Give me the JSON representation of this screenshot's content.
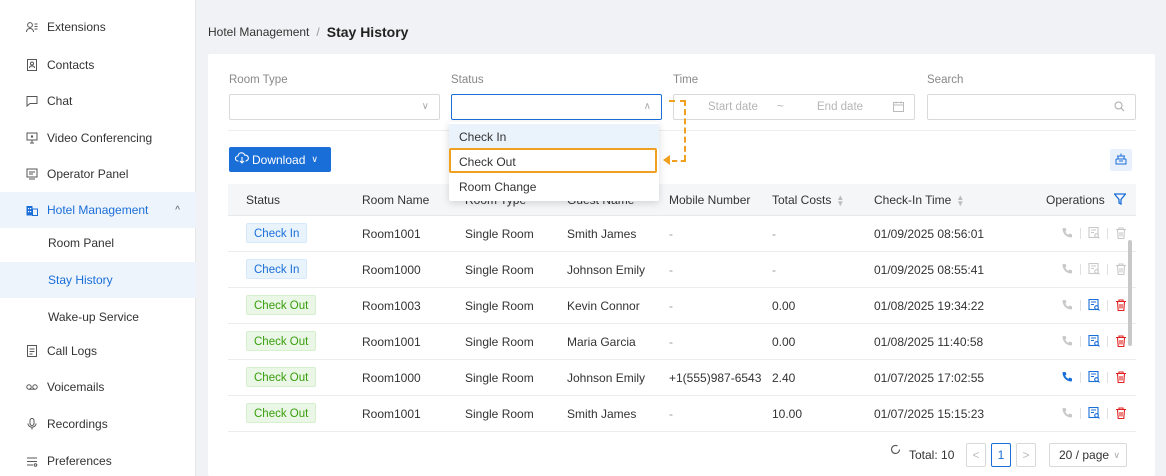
{
  "sidebar": {
    "items": [
      {
        "label": "Extensions",
        "icon": "extensions-icon"
      },
      {
        "label": "Contacts",
        "icon": "contacts-icon"
      },
      {
        "label": "Chat",
        "icon": "chat-icon"
      },
      {
        "label": "Video Conferencing",
        "icon": "video-icon"
      },
      {
        "label": "Operator Panel",
        "icon": "operator-icon"
      },
      {
        "label": "Hotel Management",
        "icon": "hotel-icon"
      },
      {
        "label": "Room Panel"
      },
      {
        "label": "Stay History"
      },
      {
        "label": "Wake-up Service"
      },
      {
        "label": "Call Logs",
        "icon": "call-logs-icon"
      },
      {
        "label": "Voicemails",
        "icon": "voicemail-icon"
      },
      {
        "label": "Recordings",
        "icon": "recordings-icon"
      },
      {
        "label": "Preferences",
        "icon": "preferences-icon"
      }
    ],
    "hotel_caret": "^"
  },
  "breadcrumb": {
    "parent": "Hotel Management",
    "separator": "/",
    "current": "Stay History"
  },
  "filters": {
    "room_type_label": "Room Type",
    "status_label": "Status",
    "time_label": "Time",
    "start_placeholder": "Start date",
    "range_sep": "~",
    "end_placeholder": "End date",
    "search_label": "Search"
  },
  "status_dropdown": {
    "options": [
      "Check In",
      "Check Out",
      "Room Change"
    ],
    "hovered": "Check In",
    "highlighted": "Check Out"
  },
  "toolbar": {
    "download_label": "Download"
  },
  "table": {
    "headers": [
      "Status",
      "Room Name",
      "Room Type",
      "Guest Name",
      "Mobile Number",
      "Total Costs",
      "Check-In Time",
      "Operations"
    ],
    "rows": [
      {
        "status": "Check In",
        "room": "Room1001",
        "type": "Single Room",
        "guest": "Smith James",
        "mobile": "-",
        "cost": "-",
        "checkin": "01/09/2025 08:56:01",
        "call": false,
        "bill": false,
        "del": false
      },
      {
        "status": "Check In",
        "room": "Room1000",
        "type": "Single Room",
        "guest": "Johnson Emily",
        "mobile": "-",
        "cost": "-",
        "checkin": "01/09/2025 08:55:41",
        "call": false,
        "bill": false,
        "del": false
      },
      {
        "status": "Check Out",
        "room": "Room1003",
        "type": "Single Room",
        "guest": "Kevin Connor",
        "mobile": "-",
        "cost": "0.00",
        "checkin": "01/08/2025 19:34:22",
        "call": false,
        "bill": true,
        "del": true
      },
      {
        "status": "Check Out",
        "room": "Room1001",
        "type": "Single Room",
        "guest": "Maria Garcia",
        "mobile": "-",
        "cost": "0.00",
        "checkin": "01/08/2025 11:40:58",
        "call": false,
        "bill": true,
        "del": true
      },
      {
        "status": "Check Out",
        "room": "Room1000",
        "type": "Single Room",
        "guest": "Johnson Emily",
        "mobile": "+1(555)987-6543",
        "cost": "2.40",
        "checkin": "01/07/2025 17:02:55",
        "call": true,
        "bill": true,
        "del": true
      },
      {
        "status": "Check Out",
        "room": "Room1001",
        "type": "Single Room",
        "guest": "Smith James",
        "mobile": "-",
        "cost": "10.00",
        "checkin": "01/07/2025 15:15:23",
        "call": false,
        "bill": true,
        "del": true
      }
    ]
  },
  "pagination": {
    "total": "Total: 10",
    "prev": "<",
    "page": "1",
    "next": ">",
    "per_page": "20 / page"
  },
  "colors": {
    "primary": "#1a6ed8",
    "highlight": "#f0a020",
    "check_in": "#1a6ed8",
    "check_out": "#389e0d",
    "delete": "#e02020"
  }
}
